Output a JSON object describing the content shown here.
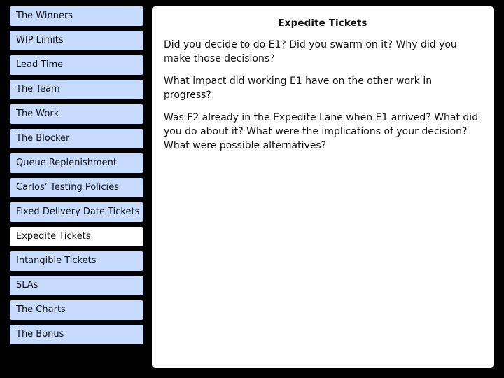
{
  "sidebar": {
    "items": [
      {
        "label": "The Winners",
        "active": false
      },
      {
        "label": "WIP Limits",
        "active": false
      },
      {
        "label": "Lead Time",
        "active": false
      },
      {
        "label": "The Team",
        "active": false
      },
      {
        "label": "The Work",
        "active": false
      },
      {
        "label": "The Blocker",
        "active": false
      },
      {
        "label": "Queue Replenishment",
        "active": false
      },
      {
        "label": "Carlos’ Testing Policies",
        "active": false
      },
      {
        "label": "Fixed Delivery Date Tickets",
        "active": false
      },
      {
        "label": "Expedite Tickets",
        "active": true
      },
      {
        "label": "Intangible Tickets",
        "active": false
      },
      {
        "label": "SLAs",
        "active": false
      },
      {
        "label": "The Charts",
        "active": false
      },
      {
        "label": "The Bonus",
        "active": false
      }
    ]
  },
  "panel": {
    "title": "Expedite Tickets",
    "questions": [
      "Did you decide to do E1? Did you swarm on it? Why did you make those decisions?",
      "What impact did working E1 have on the other work in progress?",
      "Was F2 already in the Expedite Lane when E1 arrived? What did you do about it? What were the implications of your decision? What were possible alternatives?"
    ]
  },
  "colors": {
    "background": "#000000",
    "nav_item": "#c6dbff",
    "nav_item_active": "#ffffff",
    "panel": "#ffffff"
  }
}
